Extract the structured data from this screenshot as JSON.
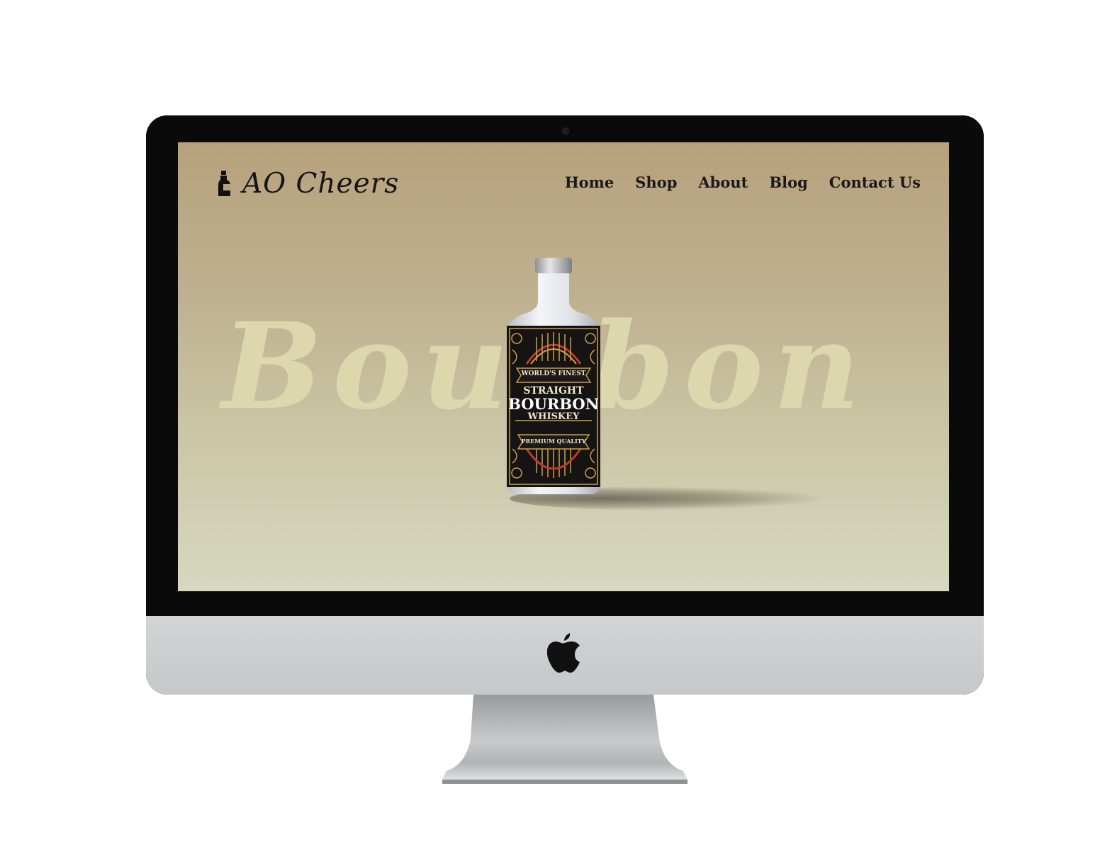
{
  "site": {
    "brand": "AO Cheers",
    "nav": [
      "Home",
      "Shop",
      "About",
      "Blog",
      "Contact Us"
    ],
    "hero_word": "Bourbon"
  },
  "bottle_label": {
    "top": "WORLD'S FINEST",
    "line1": "STRAIGHT",
    "line2": "BOURBON",
    "line3": "WHISKEY",
    "bottom": "PREMIUM QUALITY"
  },
  "colors": {
    "screen_top": "#b7a17c",
    "screen_bottom": "#d7d8c0",
    "hero_word": "#dcd7ad",
    "label_gold": "#c9a24a",
    "bezel": "#0a0a0a",
    "chin": "#cdced0"
  },
  "icons": [
    "bottle-icon",
    "apple-logo-icon",
    "camera-icon"
  ]
}
